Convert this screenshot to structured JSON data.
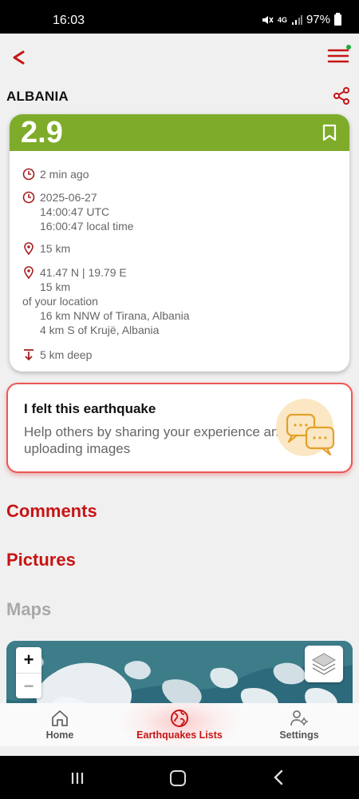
{
  "status_bar": {
    "time": "16:03",
    "network": "4G",
    "battery": "97%"
  },
  "header": {
    "location": "ALBANIA"
  },
  "quake": {
    "magnitude": "2.9",
    "ago": "2 min ago",
    "date": "2025-06-27",
    "utc_time": "14:00:47 UTC",
    "local_time": "16:00:47 local time",
    "distance": "15 km",
    "coords": "41.47 N | 19.79 E",
    "distance_value": "15 km",
    "distance_suffix": "of your location",
    "place_1": "16 km NNW of Tirana, Albania",
    "place_2": "4 km S of Krujë, Albania",
    "depth": "5 km deep"
  },
  "felt": {
    "title": "I felt this earthquake",
    "subtitle": "Help others by sharing your experience and uploading images"
  },
  "sections": {
    "comments": "Comments",
    "pictures": "Pictures",
    "maps": "Maps"
  },
  "map": {
    "zoom_in": "+",
    "zoom_out": "−"
  },
  "bottom_nav": {
    "home": "Home",
    "lists": "Earthquakes Lists",
    "settings": "Settings",
    "active": "lists"
  },
  "colors": {
    "accent": "#c71414",
    "magnitude_bar": "#7eac2a"
  }
}
